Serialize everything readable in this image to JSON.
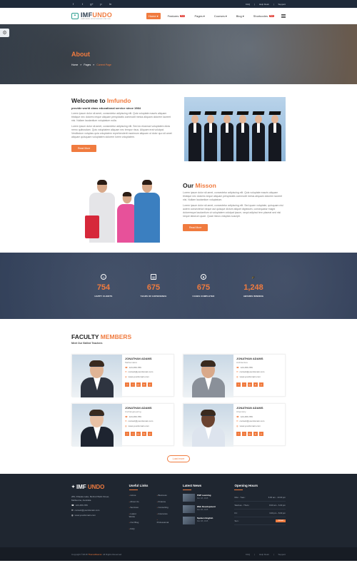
{
  "topbar": {
    "social": [
      "f",
      "t",
      "g+",
      "p",
      "in"
    ],
    "links": [
      "FAQ",
      "Help Desk",
      "Support"
    ]
  },
  "brand": {
    "name_a": "IMF",
    "name_b": "UNDO",
    "tagline": "LEARN HERE. GROW FOREVER. STAY THIS"
  },
  "nav": {
    "items": [
      {
        "label": "Home",
        "caret": "▾",
        "badge": ""
      },
      {
        "label": "Features",
        "caret": "",
        "badge": "New"
      },
      {
        "label": "Pages",
        "caret": "▾",
        "badge": ""
      },
      {
        "label": "Courses",
        "caret": "▾",
        "badge": ""
      },
      {
        "label": "Blog",
        "caret": "▾",
        "badge": ""
      },
      {
        "label": "Shortcodes",
        "caret": "",
        "badge": "New"
      }
    ]
  },
  "hero": {
    "title": "About",
    "crumbs": [
      "Home",
      "»",
      "Pages",
      "»",
      "Current Page"
    ]
  },
  "welcome": {
    "title_a": "Welcome to ",
    "title_b": "Imfundo",
    "tagline": "provide world class educational service since 1984",
    "p1": "Lorem ipsum dolor sit amet, consectetur adipiscing elit. Quis voluptate mauris aliquam tristique nec dolores neque aliquam perspiciatis commodit metus aliquam dolorem laoreet nisi. Nullam laudantium voluptatum nulla.",
    "p2": "Lorem ipsum dolor sit amet, consectetur adipiscing elit. Sed do eiusmod voluptatem dicta nemo quibusdam. Quis voluptatem aliquam nec tempor risus. Aliquam erat volutpat. Vestibulum voluptas quia voluptatem reprehenderit maximum aliquam ut dolor quo sit amet aliquam quisquam voluptatem dolorem lorem voluptatem.",
    "button": "Read More"
  },
  "mission": {
    "title_a": "Our ",
    "title_b": "Misson",
    "p1": "Lorem ipsum dolor sit amet, consectetur adipiscing elit. Quis voluptate mauris aliquam tristique nec dolores neque aliquam perspiciatis commodit metus aliquam dolorem laoreet nisi. Nullam laudantium voluptatum.",
    "p2": "Lorem ipsum dolor sit amet, consectetur adipiscing elit. Sed quam voluptate, quisquam nisi autem consecteturi neque aut quisque dictum aliquet dignissim, consequatur magni doloremque laudantium ut voluptatem volutpat ipsum, sequi adipisci tem placeat sed nisi neque laborum quae. Quae minus voluptas suscipit.",
    "button": "Read More"
  },
  "stats": [
    {
      "icon": "☺",
      "num": "754",
      "label": "HAPPY CLIENTS"
    },
    {
      "icon": "▤",
      "num": "675",
      "label": "YEARS OF EXPERIENCE"
    },
    {
      "icon": "♜",
      "num": "675",
      "label": "CASES COMPLETED"
    },
    {
      "icon": "🎓",
      "num": "1,248",
      "label": "AWARDS WINNING"
    }
  ],
  "faculty": {
    "title_a": "FACULTY ",
    "title_b": "MEMBERS",
    "sub": "Meet Our Skilled Teachers",
    "members": [
      {
        "name": "JONATHAN ADAMS",
        "dept": "Mathematics",
        "phone": "123-456-789",
        "email": "contact@yourdomain.com",
        "web": "www.yourdomain.com",
        "skin": "#e0b495",
        "shirt": "#2e3440"
      },
      {
        "name": "JONATHAN ADAMS",
        "dept": "Architecture",
        "phone": "123-456-789",
        "email": "contact@yourdomain.com",
        "web": "www.yourdomain.com",
        "skin": "#d9a98a",
        "shirt": "#8a9099"
      },
      {
        "name": "JONATHAN ADAMS",
        "dept": "Civil Engineering",
        "phone": "123-456-789",
        "email": "contact@yourdomain.com",
        "web": "www.yourdomain.com",
        "skin": "#e8c0a4",
        "shirt": "#1e2430"
      },
      {
        "name": "JONATHAN ADAMS",
        "dept": "Chemistry",
        "phone": "123-456-789",
        "email": "contact@yourdomain.com",
        "web": "www.yourdomain.com",
        "skin": "#6b4330",
        "shirt": "#dde4ee"
      }
    ],
    "social": [
      "f",
      "t",
      "g+",
      "in",
      "p"
    ],
    "load_more": "Load more"
  },
  "footer": {
    "address": "283, Dhaaka Lake, Behind Wells Street, Melbourne, Australia.",
    "phone": "123-456-789",
    "email": "contact@yourdomain.com",
    "web": "www.yourdomain.com",
    "useful_links_title": "Useful Links",
    "links_col1": [
      "Home",
      "About Us",
      "Services",
      "Latest Works",
      "Our Blog",
      "FAQ"
    ],
    "links_col2": [
      "Business",
      "Finance",
      "Consulting",
      "Insurance",
      "Professional"
    ],
    "news_title": "Latest News",
    "news": [
      {
        "title": "PHP Learning",
        "date": "Dec 08, 2015"
      },
      {
        "title": "Web Development",
        "date": "Dec 08, 2015"
      },
      {
        "title": "Spoken English",
        "date": "Dec 08, 2015"
      }
    ],
    "hours_title": "Opening Hours",
    "hours": [
      {
        "day": "Mon - Tues :",
        "time": "6.00 am - 10.00 pm",
        "closed": false
      },
      {
        "day": "Wednes - Thurs :",
        "time": "8.00 am - 6.00 pm",
        "closed": false
      },
      {
        "day": "Fri :",
        "time": "3.00 pm - 8.00 pm",
        "closed": false
      },
      {
        "day": "Sun :",
        "time": "Closed",
        "closed": true
      }
    ],
    "copyright_a": "Copyright ©2018 ",
    "copyright_b": "ThemeMascot",
    "copyright_c": ". All Rights Reserved",
    "bottom_links": [
      "FAQ",
      "Help Desk",
      "Support"
    ]
  },
  "colors": {
    "accent": "#f07b3f",
    "dark": "#1f2630"
  }
}
